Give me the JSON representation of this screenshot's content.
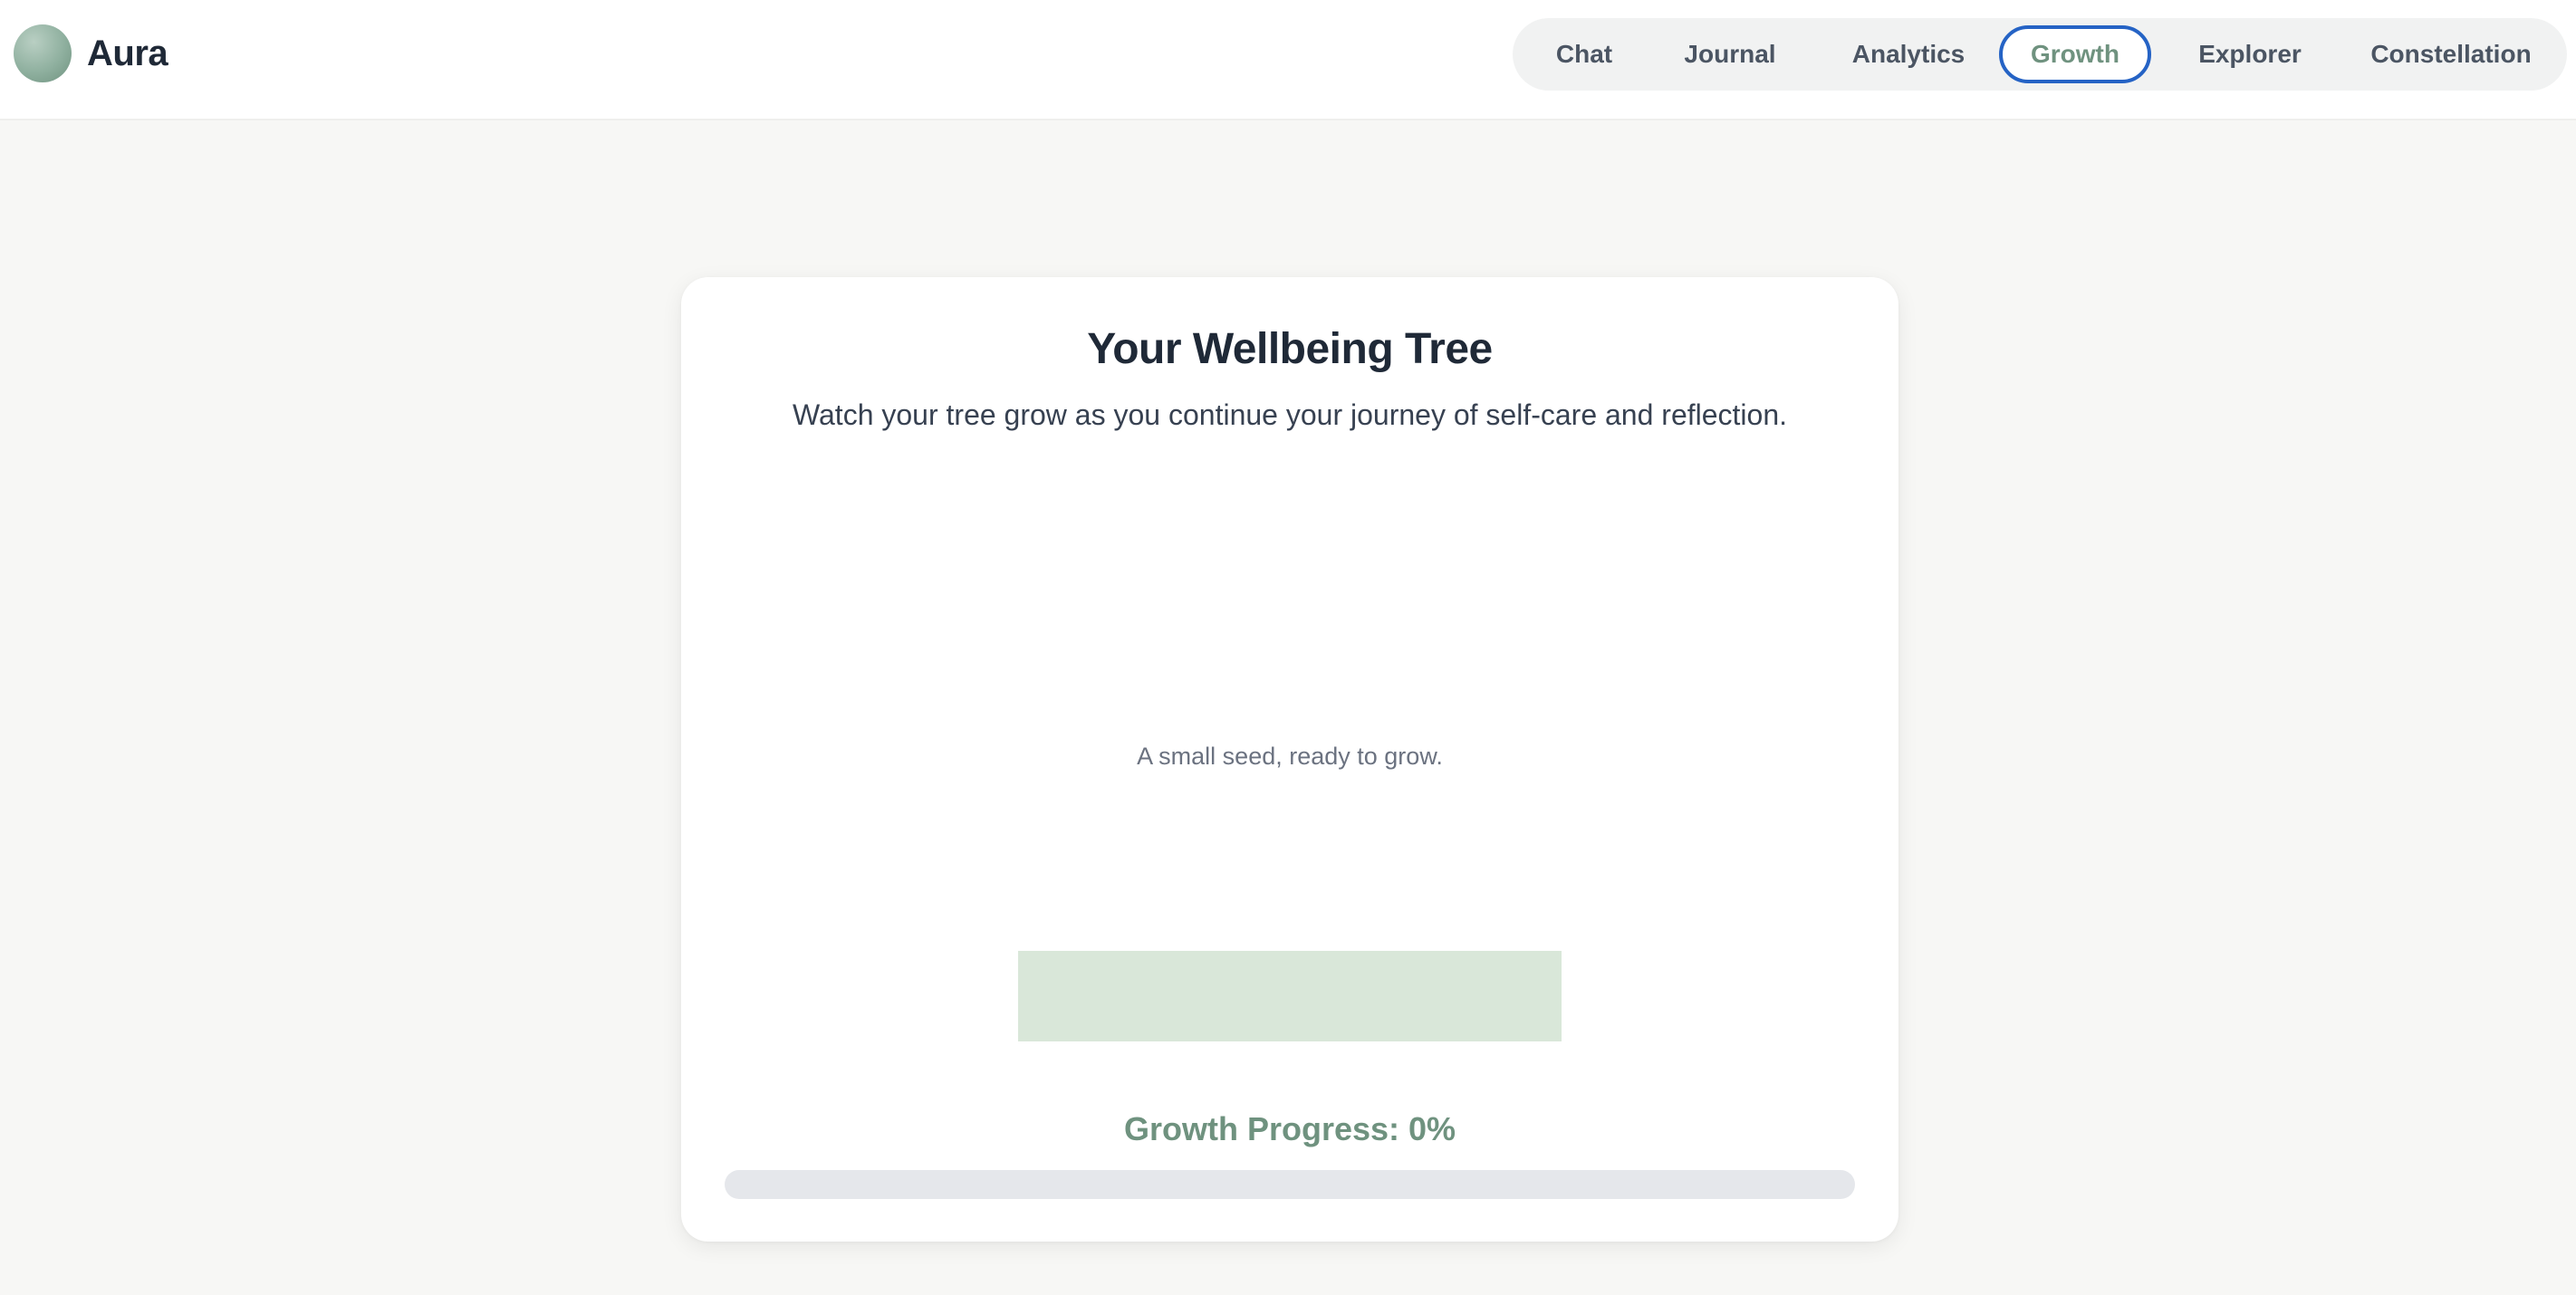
{
  "app": {
    "name": "Aura"
  },
  "nav": {
    "items": [
      {
        "label": "Chat"
      },
      {
        "label": "Journal"
      },
      {
        "label": "Analytics"
      },
      {
        "label": "Growth",
        "active": true
      },
      {
        "label": "Explorer"
      },
      {
        "label": "Constellation"
      }
    ]
  },
  "growth": {
    "title": "Your Wellbeing Tree",
    "subtitle": "Watch your tree grow as you continue your journey of self-care and reflection.",
    "stage_caption": "A small seed, ready to grow.",
    "progress_label": "Growth Progress: 0%",
    "progress_fraction": 0
  },
  "colors": {
    "accent": "#6f927f",
    "active_outline": "#2563c5",
    "ground": "#d9e7d9",
    "progress_track": "#e5e7eb"
  }
}
